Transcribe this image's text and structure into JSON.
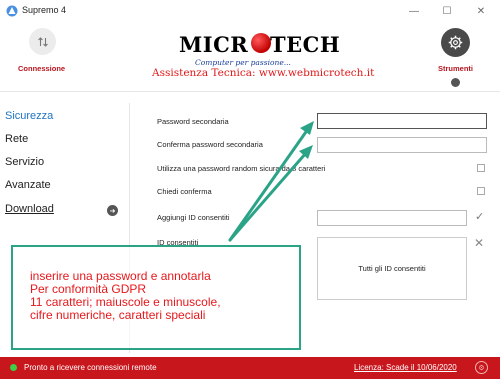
{
  "window": {
    "title": "Supremo 4",
    "minimize_glyph": "—",
    "maximize_glyph": "☐",
    "close_glyph": "✕"
  },
  "header": {
    "connection_label": "Connessione",
    "connection_icon": "swap-arrows-icon",
    "tools_label": "Strumenti",
    "tools_icon": "gear-icon",
    "logo_left": "MICR",
    "logo_right": "TECH",
    "logo_tagline": "Computer per passione...",
    "assistance": "Assistenza Tecnica: www.webmicrotech.it"
  },
  "sidebar": {
    "items": [
      {
        "label": "Sicurezza",
        "active": true
      },
      {
        "label": "Rete"
      },
      {
        "label": "Servizio"
      },
      {
        "label": "Avanzate"
      },
      {
        "label": "Download",
        "link": true
      }
    ],
    "download_icon": "arrow-right-circle-icon"
  },
  "form": {
    "password_label": "Password secondaria",
    "password_value": "",
    "confirm_label": "Conferma password secondaria",
    "confirm_value": "",
    "random_label": "Utilizza una password random sicura da 8 caratteri",
    "confirm_request_label": "Chiedi conferma",
    "add_id_label": "Aggiungi ID consentiti",
    "add_id_value": "",
    "id_allowed_label": "ID consentiti",
    "all_ids_text": "Tutti gli ID consentiti"
  },
  "annotation": {
    "lines": [
      "inserire una password e annotarla",
      "Per conformità GDPR",
      "11 caratteri; maiuscole e minuscole,",
      "cifre numeriche, caratteri speciali"
    ],
    "arrow_color": "#2ba387",
    "text_color": "#e8181c"
  },
  "status": {
    "text": "Pronto a ricevere connessioni remote",
    "license": "Licenza: Scade il 10/06/2020",
    "bar_color": "#c8161d",
    "indicator_color": "#3ad147"
  }
}
